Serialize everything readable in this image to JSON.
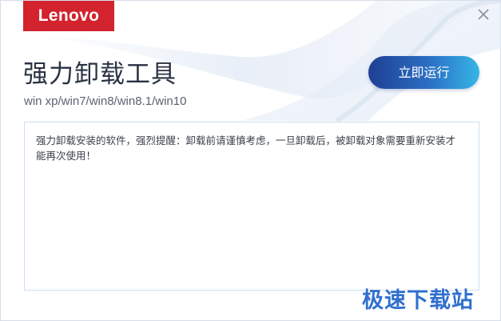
{
  "window": {
    "logo_text": "Lenovo",
    "close_icon": "close-icon",
    "close_symbol": "×"
  },
  "header": {
    "title": "强力卸载工具",
    "subtitle": "win xp/win7/win8/win8.1/win10"
  },
  "actions": {
    "run_label": "立即运行"
  },
  "notice": {
    "text": "强力卸载安装的软件，强烈提醒：卸载前请谨慎考虑，一旦卸载后，被卸载对象需要重新安装才能再次使用！"
  },
  "watermark": {
    "text": "极速下载站"
  },
  "colors": {
    "brand_red": "#d2232e",
    "button_gradient_start": "#1f3f93",
    "button_gradient_end": "#36b6e6",
    "watermark_blue": "#2f6fcf"
  }
}
